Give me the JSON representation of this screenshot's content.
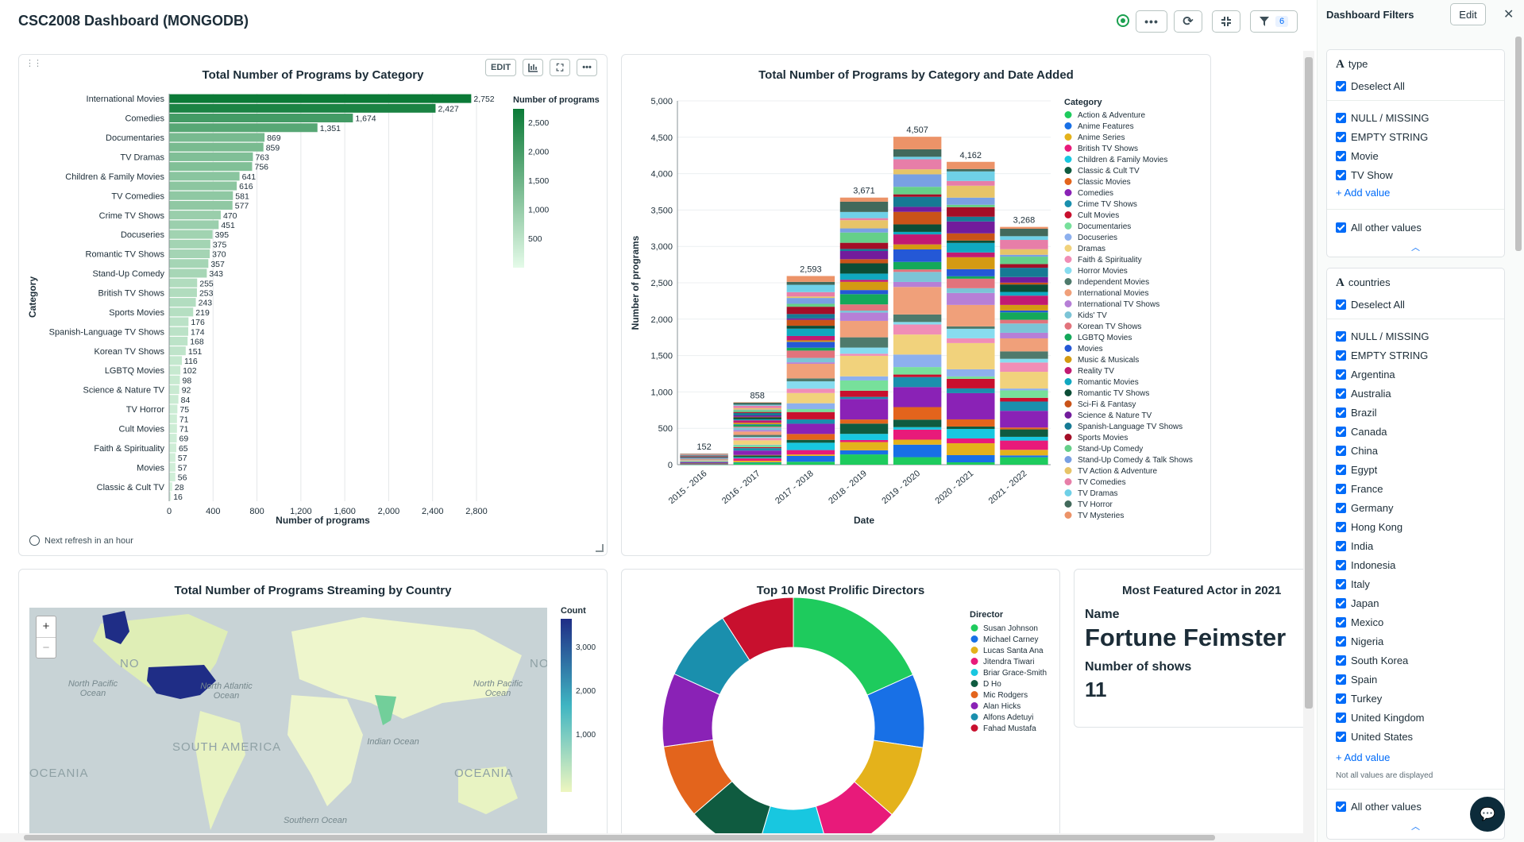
{
  "dashboard": {
    "title": "CSC2008 Dashboard (MONGODB)",
    "menu_icon": "ellipsis-icon",
    "refresh_icon": "refresh-icon",
    "collapse_icon": "collapse-icon",
    "filter_count": "6"
  },
  "cards": {
    "category_bar": {
      "title": "Total Number of Programs by Category",
      "edit_label": "EDIT",
      "refresh_note": "Next refresh in an hour"
    },
    "category_date": {
      "title": "Total Number of Programs by Category and Date Added"
    },
    "country_map": {
      "title": "Total Number of Programs Streaming by Country",
      "legend_title": "Count",
      "legend_ticks": [
        "3,000",
        "2,000",
        "1,000"
      ],
      "zoom_in": "+",
      "zoom_out": "−",
      "labels": {
        "north_pacific_left": "North Pacific Ocean",
        "north_atlantic": "North Atlantic Ocean",
        "north_pacific_right": "North Pacific Ocean",
        "indian_ocean": "Indian Ocean",
        "southern_ocean": "Southern Ocean",
        "south_america": "SOUTH AMERICA",
        "oceania_left": "OCEANIA",
        "oceania_right": "OCEANIA",
        "na_left": "NO",
        "na_right": "NO"
      }
    },
    "directors": {
      "title": "Top 10 Most Prolific Directors",
      "legend_title": "Director"
    },
    "featured_actor": {
      "title": "Most Featured Actor in 2021",
      "name_label": "Name",
      "name_value": "Fortune Feimster",
      "shows_label": "Number of shows",
      "shows_value": "11"
    }
  },
  "chart_data": [
    {
      "type": "bar",
      "orientation": "horizontal",
      "title": "Total Number of Programs by Category",
      "xlabel": "Number of programs",
      "ylabel": "Category",
      "xlim": [
        0,
        2800
      ],
      "xticks": [
        "0",
        "400",
        "800",
        "1,200",
        "1,600",
        "2,000",
        "2,400",
        "2,800"
      ],
      "yticklabels": [
        "International Movies",
        "Comedies",
        "Documentaries",
        "TV Dramas",
        "Children & Family Movies",
        "TV Comedies",
        "Crime TV Shows",
        "Docuseries",
        "Romantic TV Shows",
        "Stand-Up Comedy",
        "British TV Shows",
        "Sports Movies",
        "Spanish-Language TV Shows",
        "Korean TV Shows",
        "LGBTQ Movies",
        "Science & Nature TV",
        "TV Horror",
        "Cult Movies",
        "Faith & Spirituality",
        "Movies",
        "Classic & Cult TV"
      ],
      "values": [
        2752,
        2427,
        1674,
        1351,
        869,
        859,
        763,
        756,
        641,
        616,
        581,
        577,
        470,
        451,
        395,
        375,
        370,
        357,
        343,
        255,
        253,
        243,
        219,
        176,
        174,
        168,
        151,
        116,
        102,
        98,
        92,
        84,
        75,
        71,
        71,
        69,
        65,
        57,
        57,
        56,
        28,
        16
      ],
      "value_labels": [
        "2,752",
        "2,427",
        "1,674",
        "1,351",
        "869",
        "859",
        "763",
        "756",
        "641",
        "616",
        "581",
        "577",
        "470",
        "451",
        "395",
        "375",
        "370",
        "357",
        "343",
        "255",
        "253",
        "243",
        "219",
        "176",
        "174",
        "168",
        "151",
        "116",
        "102",
        "98",
        "92",
        "84",
        "75",
        "71",
        "71",
        "69",
        "65",
        "57",
        "57",
        "56",
        "28",
        "16"
      ],
      "color_legend": {
        "title": "Number of programs",
        "ticks": [
          "2,500",
          "2,000",
          "1,500",
          "1,000",
          "500"
        ]
      }
    },
    {
      "type": "bar",
      "stacked": true,
      "title": "Total Number of Programs by Category and Date Added",
      "xlabel": "Date",
      "ylabel": "Number of programs",
      "ylim": [
        0,
        5000
      ],
      "yticks": [
        "0",
        "500",
        "1,000",
        "1,500",
        "2,000",
        "2,500",
        "3,000",
        "3,500",
        "4,000",
        "4,500",
        "5,000"
      ],
      "categories": [
        "2015 - 2016",
        "2016 - 2017",
        "2017 - 2018",
        "2018 - 2019",
        "2019 - 2020",
        "2020 - 2021",
        "2021 - 2022"
      ],
      "totals": [
        152,
        858,
        2593,
        3671,
        4507,
        4162,
        3268
      ],
      "total_labels": [
        "152",
        "858",
        "2,593",
        "3,671",
        "4,507",
        "4,162",
        "3,268"
      ],
      "legend_title": "Category",
      "series": [
        {
          "name": "Action & Adventure",
          "color": "#1ecb5d"
        },
        {
          "name": "Anime Features",
          "color": "#1870e6"
        },
        {
          "name": "Anime Series",
          "color": "#e4b21b"
        },
        {
          "name": "British TV Shows",
          "color": "#e81a7a"
        },
        {
          "name": "Children & Family Movies",
          "color": "#18c7e0"
        },
        {
          "name": "Classic & Cult TV",
          "color": "#0f5b40"
        },
        {
          "name": "Classic Movies",
          "color": "#e3641c"
        },
        {
          "name": "Comedies",
          "color": "#8a22b6"
        },
        {
          "name": "Crime TV Shows",
          "color": "#1a8fad"
        },
        {
          "name": "Cult Movies",
          "color": "#c8102e"
        },
        {
          "name": "Documentaries",
          "color": "#77e09b"
        },
        {
          "name": "Docuseries",
          "color": "#8db0ee"
        },
        {
          "name": "Dramas",
          "color": "#f1d27c"
        },
        {
          "name": "Faith & Spirituality",
          "color": "#f08db6"
        },
        {
          "name": "Horror Movies",
          "color": "#87dcef"
        },
        {
          "name": "Independent Movies",
          "color": "#4e7a6c"
        },
        {
          "name": "International Movies",
          "color": "#f0a07a"
        },
        {
          "name": "International TV Shows",
          "color": "#b67fd6"
        },
        {
          "name": "Kids' TV",
          "color": "#7cc4d6"
        },
        {
          "name": "Korean TV Shows",
          "color": "#e2737c"
        },
        {
          "name": "LGBTQ Movies",
          "color": "#14a85a"
        },
        {
          "name": "Movies",
          "color": "#2458d6"
        },
        {
          "name": "Music & Musicals",
          "color": "#d49a12"
        },
        {
          "name": "Reality TV",
          "color": "#c11a72"
        },
        {
          "name": "Romantic Movies",
          "color": "#10a8c0"
        },
        {
          "name": "Romantic TV Shows",
          "color": "#0b4d36"
        },
        {
          "name": "Sci-Fi & Fantasy",
          "color": "#c95318"
        },
        {
          "name": "Science & Nature TV",
          "color": "#721c9c"
        },
        {
          "name": "Spanish-Language TV Shows",
          "color": "#167a94"
        },
        {
          "name": "Sports Movies",
          "color": "#a30e27"
        },
        {
          "name": "Stand-Up Comedy",
          "color": "#65cf89"
        },
        {
          "name": "Stand-Up Comedy & Talk Shows",
          "color": "#79a0e3"
        },
        {
          "name": "TV Action & Adventure",
          "color": "#e7c468"
        },
        {
          "name": "TV Comedies",
          "color": "#e77ea8"
        },
        {
          "name": "TV Dramas",
          "color": "#6fd0e7"
        },
        {
          "name": "TV Horror",
          "color": "#42695b"
        },
        {
          "name": "TV Mysteries",
          "color": "#ec9368"
        }
      ]
    },
    {
      "type": "pie",
      "donut": true,
      "title": "Top 10 Most Prolific Directors",
      "legend_title": "Director",
      "labels": [
        "Susan Johnson",
        "Michael Carney",
        "Lucas Santa Ana",
        "Jitendra Tiwari",
        "Briar Grace-Smith",
        "D Ho",
        "Mic Rodgers",
        "Alan Hicks",
        "Alfons Adetuyi",
        "Fahad Mustafa"
      ],
      "colors": [
        "#1ecb5d",
        "#1870e6",
        "#e4b21b",
        "#e81a7a",
        "#18c7e0",
        "#0f5b40",
        "#e3641c",
        "#8a22b6",
        "#1a8fad",
        "#c8102e"
      ],
      "values": [
        16.7,
        8.3,
        8.3,
        8.3,
        8.3,
        8.3,
        8.3,
        8.3,
        8.3,
        8.3
      ]
    }
  ],
  "filters": {
    "title": "Dashboard Filters",
    "edit_label": "Edit",
    "close_icon": "close-icon",
    "type": {
      "name": "type",
      "icon": "A",
      "deselect": "Deselect All",
      "values": [
        "NULL / MISSING",
        "EMPTY STRING",
        "Movie",
        "TV Show"
      ],
      "add_value": "Add value",
      "all_other": "All other values"
    },
    "countries": {
      "name": "countries",
      "icon": "A",
      "deselect": "Deselect All",
      "values": [
        "NULL / MISSING",
        "EMPTY STRING",
        "Argentina",
        "Australia",
        "Brazil",
        "Canada",
        "China",
        "Egypt",
        "France",
        "Germany",
        "Hong Kong",
        "India",
        "Indonesia",
        "Italy",
        "Japan",
        "Mexico",
        "Nigeria",
        "South Korea",
        "Spain",
        "Turkey",
        "United Kingdom",
        "United States"
      ],
      "add_value": "Add value",
      "note": "Not all values are displayed",
      "all_other": "All other values"
    }
  }
}
